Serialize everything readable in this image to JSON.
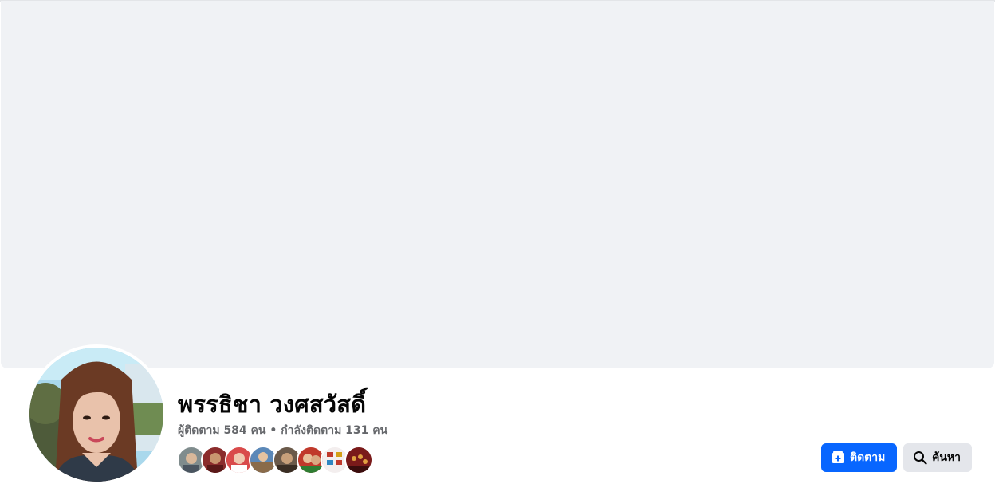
{
  "profile": {
    "name": "พรรธิชา วงศสวัสดิ์",
    "followers_text": "ผู้ติดตาม 584 คน",
    "separator": " • ",
    "following_text": "กำลังติดตาม 131 คน"
  },
  "follower_avatars": [
    {
      "name": "follower-avatar-1",
      "color": "#7f8c8d"
    },
    {
      "name": "follower-avatar-2",
      "color": "#8b2c2c"
    },
    {
      "name": "follower-avatar-3",
      "color": "#d94b4b"
    },
    {
      "name": "follower-avatar-4",
      "color": "#5b88b8"
    },
    {
      "name": "follower-avatar-5",
      "color": "#6b5a4a"
    },
    {
      "name": "follower-avatar-6",
      "color": "#c0392b"
    },
    {
      "name": "follower-avatar-7",
      "color": "#f3eeee"
    },
    {
      "name": "follower-avatar-8",
      "color": "#7a1a1a"
    }
  ],
  "actions": {
    "follow_label": "ติดตาม",
    "follow_icon": "add-friend-icon",
    "search_label": "ค้นหา",
    "search_icon": "search-icon"
  },
  "colors": {
    "cover": "#f0f2f5",
    "primary": "#0866ff",
    "secondary_button": "#e4e6eb",
    "muted_text": "#65676b"
  }
}
